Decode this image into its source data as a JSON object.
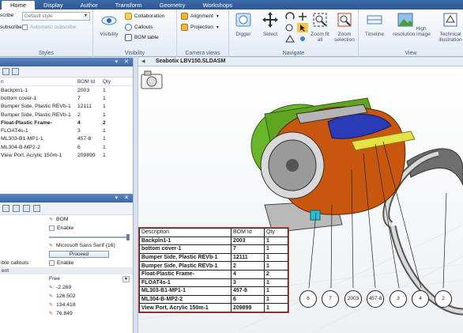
{
  "tabs": [
    "Home",
    "Display",
    "Author",
    "Transform",
    "Geometry",
    "Workshops"
  ],
  "styles_group": {
    "caption": "Styles",
    "style_value": "Default style",
    "subscribe_label": "scribe",
    "unsubscribe_label": "subscribe",
    "auto_subscribe_label": "Automatic subscribe"
  },
  "visibility_group": {
    "caption": "Visibility",
    "visibility_label": "Visibility",
    "collaboration_label": "Collaboration",
    "callouts_label": "Callouts",
    "bom_table_label": "BOM table"
  },
  "camera_group": {
    "caption": "Camera views",
    "alignment_label": "Alignment",
    "projection_label": "Projection"
  },
  "navigate_group": {
    "caption": "Navigate",
    "digger_label": "Digger",
    "select_label": "Select",
    "zoom_fit_label": "Zoom fit all",
    "zoom_selection_label": "Zoom selection"
  },
  "view_group": {
    "caption": "View",
    "timeline_label": "Timeline",
    "hires_label": "High resolution image",
    "tech_label": "Technical illustration"
  },
  "bom_panel": {
    "header_col1": "n",
    "header_col2": "BOM Id",
    "header_col3": "Qty",
    "rows": [
      {
        "name": "Backpln1-1",
        "id": "2003",
        "qty": "1",
        "bold": false
      },
      {
        "name": "bottom cover-1",
        "id": "7",
        "qty": "1",
        "bold": false
      },
      {
        "name": "Bumper Side, Plastic REVb-1",
        "id": "12111",
        "qty": "1",
        "bold": false
      },
      {
        "name": "Bumper Side, Plastic REVb-1",
        "id": "2",
        "qty": "1",
        "bold": false
      },
      {
        "name": "Float-Plastic Frame-",
        "id": "4",
        "qty": "2",
        "bold": true
      },
      {
        "name": "FLOAT4s-1",
        "id": "3",
        "qty": "1",
        "bold": false
      },
      {
        "name": "ML303-B1-MP1-1",
        "id": "457-8",
        "qty": "1",
        "bold": false
      },
      {
        "name": "ML304-B-MP2-2",
        "id": "6",
        "qty": "1",
        "bold": false
      },
      {
        "name": "View Port, Acrylic 150m-1",
        "id": "209899",
        "qty": "1",
        "bold": false
      }
    ]
  },
  "props_panel": {
    "bom_value": "BOM",
    "enable_label": "Enable",
    "font_value": "Microsoft Sans Serif (16)",
    "proceed_label": "Proceed",
    "callouts_key": "ible callouts",
    "enable2_label": "Enable",
    "section_label": "ent",
    "free_value": "Free",
    "coords": [
      "-2.269",
      "126.502",
      "134.418",
      "76.849"
    ]
  },
  "document": {
    "title": "Seabotix LBV150.SLDASM"
  },
  "bom_table": {
    "header": [
      "Description",
      "BOM Id",
      "Qty"
    ],
    "rows": [
      [
        "Backpln1-1",
        "2003",
        "1"
      ],
      [
        "bottom cover-1",
        "7",
        "1"
      ],
      [
        "Bumper Side, Plastic REVb-1",
        "12111",
        "1"
      ],
      [
        "Bumper Side, Plastic REVb-1",
        "2",
        "1"
      ],
      [
        "Float-Plastic Frame-",
        "4",
        "2"
      ],
      [
        "FLOAT4s-1",
        "3",
        "1"
      ],
      [
        "ML303-B1-MP1-1",
        "457-8",
        "1"
      ],
      [
        "ML304-B-MP2-2",
        "6",
        "1"
      ],
      [
        "View Port, Acrylic 150m-1",
        "209899",
        "1"
      ]
    ]
  },
  "balloons": [
    "6",
    "7",
    "2003",
    "457-8",
    "3",
    "4",
    "2"
  ],
  "colors": {
    "ribbon_blue": "#2d5691",
    "panel_header": "#3a65a3",
    "table_border": "#e24a3f",
    "model_orange": "#c9560e",
    "model_green": "#5fae1e"
  }
}
